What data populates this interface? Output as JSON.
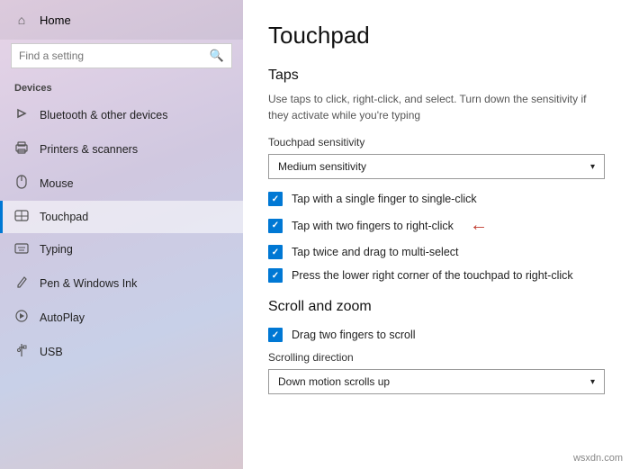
{
  "sidebar": {
    "home_label": "Home",
    "search_placeholder": "Find a setting",
    "devices_label": "Devices",
    "items": [
      {
        "id": "bluetooth",
        "label": "Bluetooth & other devices",
        "icon": "📶"
      },
      {
        "id": "printers",
        "label": "Printers & scanners",
        "icon": "🖨"
      },
      {
        "id": "mouse",
        "label": "Mouse",
        "icon": "🖱"
      },
      {
        "id": "touchpad",
        "label": "Touchpad",
        "icon": "▭",
        "active": true
      },
      {
        "id": "typing",
        "label": "Typing",
        "icon": "⌨"
      },
      {
        "id": "pen",
        "label": "Pen & Windows Ink",
        "icon": "✒"
      },
      {
        "id": "autoplay",
        "label": "AutoPlay",
        "icon": "▶"
      },
      {
        "id": "usb",
        "label": "USB",
        "icon": "⚡"
      }
    ]
  },
  "main": {
    "page_title": "Touchpad",
    "taps_section": {
      "title": "Taps",
      "description": "Use taps to click, right-click, and select. Turn down the sensitivity if they activate while you're typing",
      "sensitivity_label": "Touchpad sensitivity",
      "sensitivity_value": "Medium sensitivity",
      "checkboxes": [
        {
          "id": "single",
          "label": "Tap with a single finger to single-click",
          "checked": true
        },
        {
          "id": "rightclick",
          "label": "Tap with two fingers to right-click",
          "checked": true,
          "annotated": true
        },
        {
          "id": "drag",
          "label": "Tap twice and drag to multi-select",
          "checked": true
        },
        {
          "id": "corner",
          "label": "Press the lower right corner of the touchpad to right-click",
          "checked": true
        }
      ]
    },
    "scroll_section": {
      "title": "Scroll and zoom",
      "checkboxes": [
        {
          "id": "scroll",
          "label": "Drag two fingers to scroll",
          "checked": true
        }
      ],
      "direction_label": "Scrolling direction",
      "direction_value": "Down motion scrolls up"
    }
  },
  "watermark": "wsxdn.com"
}
